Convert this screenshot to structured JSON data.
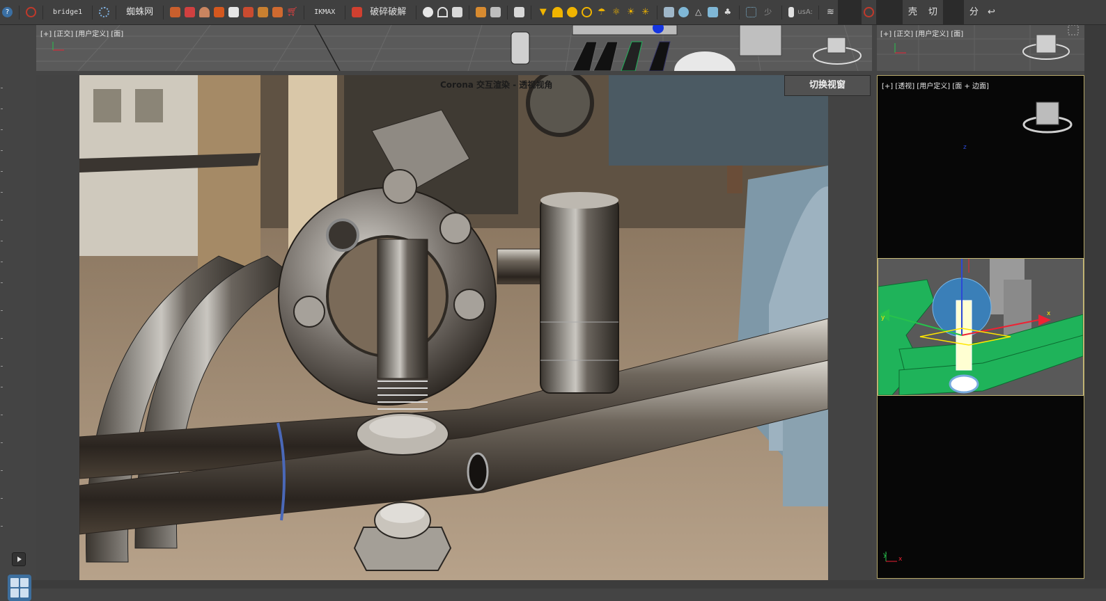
{
  "toolbar": {
    "bridge_label": "bridge1",
    "spider_label": "蜘蛛网",
    "ikmax_label": "IKMAX",
    "fracture_label": "破碎破解",
    "unit_label": "少",
    "usa_label": "usA:",
    "shell_label": "壳",
    "cut_label": "切",
    "split_label": "分",
    "icons": [
      "help-icon",
      "undo-swirl-icon",
      "gear-icon",
      "teapot-icon",
      "vase-icon",
      "box-icon",
      "cart-icon",
      "sphere-icon",
      "light-icon",
      "cube-icon",
      "layers-icon",
      "grid-icon",
      "redo-icon"
    ]
  },
  "viewports": {
    "ortho_top_label": "[+] [正交] [用户定义] [面]",
    "ortho_right_label": "[+] [正交] [用户定义] [面]",
    "persp_label": "[+] [透视] [用户定义] [面 + 边面]",
    "render_title": "Corona 交互渲染 - 透视视角",
    "switch_button": "切换视窗"
  },
  "axis_labels": {
    "x": "x",
    "y": "y",
    "z": "z"
  },
  "colors": {
    "ui_bg": "#444444",
    "toolbar_bg": "#404040",
    "selection_border": "#c9bd7a",
    "wireframe_green": "#1fb35a",
    "layout_button": "#3d6f9e"
  }
}
